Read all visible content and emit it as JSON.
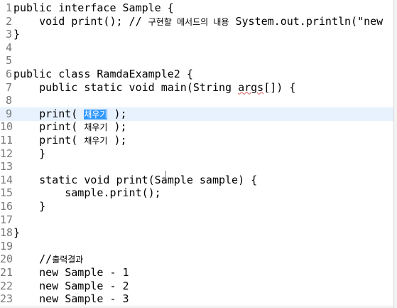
{
  "editor": {
    "lines": [
      {
        "n": "1",
        "segs": [
          {
            "t": "public interface Sample {"
          }
        ]
      },
      {
        "n": "2",
        "segs": [
          {
            "t": "    void print(); // "
          },
          {
            "t": "구현할 메서드의 내용",
            "ko": true
          },
          {
            "t": " System.out.println(\"new"
          }
        ]
      },
      {
        "n": "3",
        "segs": [
          {
            "t": "}"
          }
        ]
      },
      {
        "n": "4",
        "segs": []
      },
      {
        "n": "5",
        "segs": []
      },
      {
        "n": "6",
        "segs": [
          {
            "t": "public class RamdaExample2 {"
          }
        ]
      },
      {
        "n": "7",
        "segs": [
          {
            "t": "    public static void main(String "
          },
          {
            "t": "args",
            "squiggle": true
          },
          {
            "t": "[]) {"
          }
        ]
      },
      {
        "n": "8",
        "segs": []
      },
      {
        "n": "9",
        "current": true,
        "segs": [
          {
            "t": "    print( "
          },
          {
            "t": "채우기",
            "ko": true,
            "sel": true
          },
          {
            "t": " );"
          }
        ]
      },
      {
        "n": "10",
        "segs": [
          {
            "t": "    print( "
          },
          {
            "t": "채우기",
            "ko": true
          },
          {
            "t": " );"
          }
        ]
      },
      {
        "n": "11",
        "segs": [
          {
            "t": "    print( "
          },
          {
            "t": "채우기",
            "ko": true
          },
          {
            "t": " );"
          }
        ]
      },
      {
        "n": "12",
        "segs": [
          {
            "t": "    }"
          }
        ]
      },
      {
        "n": "13",
        "segs": []
      },
      {
        "n": "14",
        "segs": [
          {
            "t": "    static void print(Sample sample) {"
          }
        ]
      },
      {
        "n": "15",
        "segs": [
          {
            "t": "        sample.print();"
          }
        ]
      },
      {
        "n": "16",
        "segs": [
          {
            "t": "    }"
          }
        ]
      },
      {
        "n": "17",
        "segs": []
      },
      {
        "n": "18",
        "segs": [
          {
            "t": "}"
          }
        ]
      },
      {
        "n": "19",
        "segs": []
      },
      {
        "n": "20",
        "segs": [
          {
            "t": "    //"
          },
          {
            "t": "출력결과",
            "ko": true
          }
        ]
      },
      {
        "n": "21",
        "segs": [
          {
            "t": "    new Sample - 1"
          }
        ]
      },
      {
        "n": "22",
        "segs": [
          {
            "t": "    new Sample - 2"
          }
        ]
      },
      {
        "n": "23",
        "segs": [
          {
            "t": "    new Sample - 3"
          }
        ]
      }
    ]
  }
}
